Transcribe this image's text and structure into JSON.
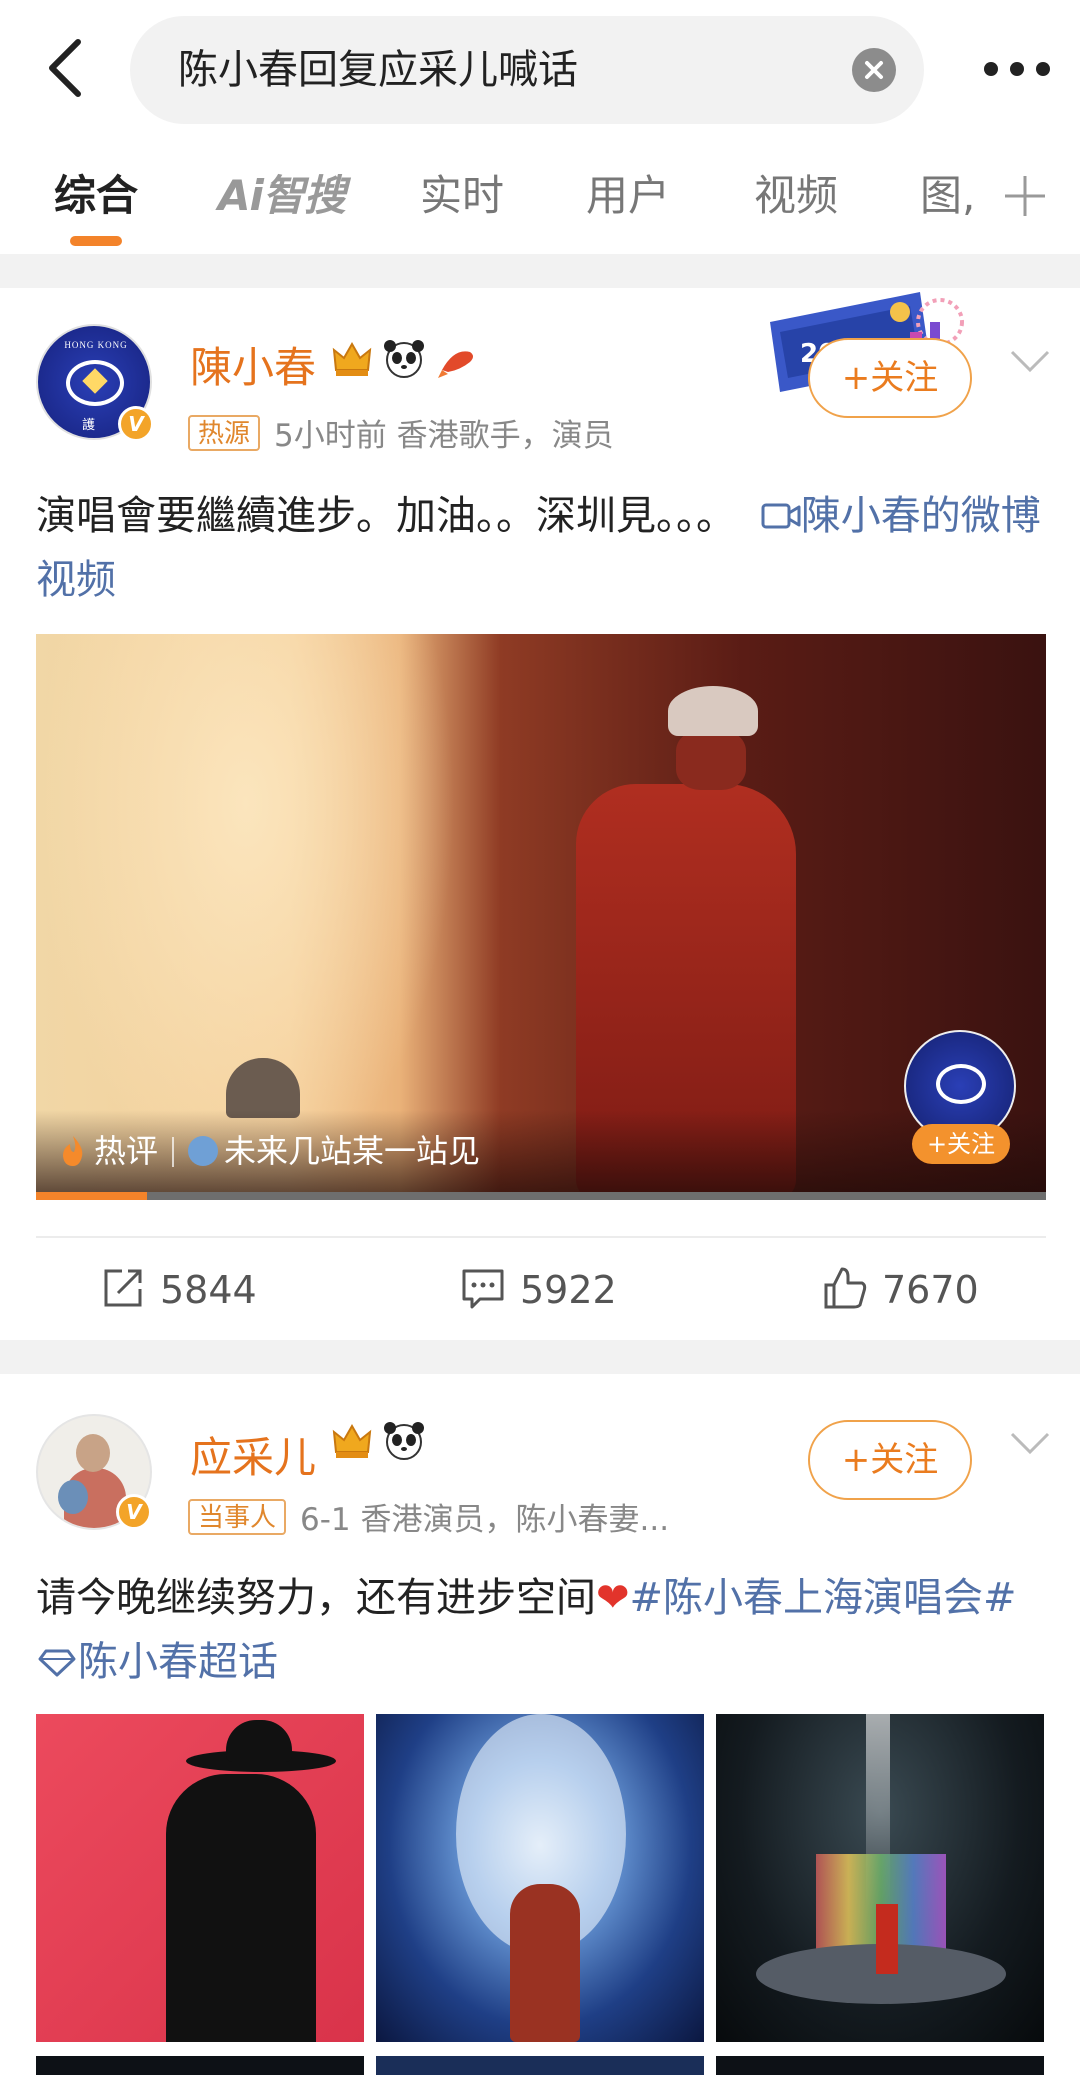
{
  "header": {
    "search_query": "陈小春回复应采儿喊话"
  },
  "tabs": [
    {
      "label": "综合",
      "active": true
    },
    {
      "label": "Ai智搜",
      "active": false
    },
    {
      "label": "实时",
      "active": false
    },
    {
      "label": "用户",
      "active": false
    },
    {
      "label": "视频",
      "active": false
    },
    {
      "label": "图,",
      "active": false
    }
  ],
  "accent_color": "#f3832a",
  "posts": [
    {
      "username": "陳小春",
      "badge": "热源",
      "meta": "5小时前  香港歌手，演员",
      "follow_label": "+关注",
      "text": "演唱會要繼續進步。加油。。深圳見。。。",
      "video_link": "陳小春的微博视频",
      "video": {
        "hot_label": "热评",
        "hot_comment": "未来几站某一站见",
        "follow_label": "+关注",
        "progress": 0.11
      },
      "actions": {
        "repost": "5844",
        "comment": "5922",
        "like": "7670"
      }
    },
    {
      "username": "应采儿",
      "badge": "当事人",
      "meta": "6-1  香港演员，陈小春妻...",
      "follow_label": "+关注",
      "text": "请今晚继续努力，还有进步空间",
      "hashtag": "#陈小春上海演唱会#",
      "supertopic": "陈小春超话"
    }
  ]
}
